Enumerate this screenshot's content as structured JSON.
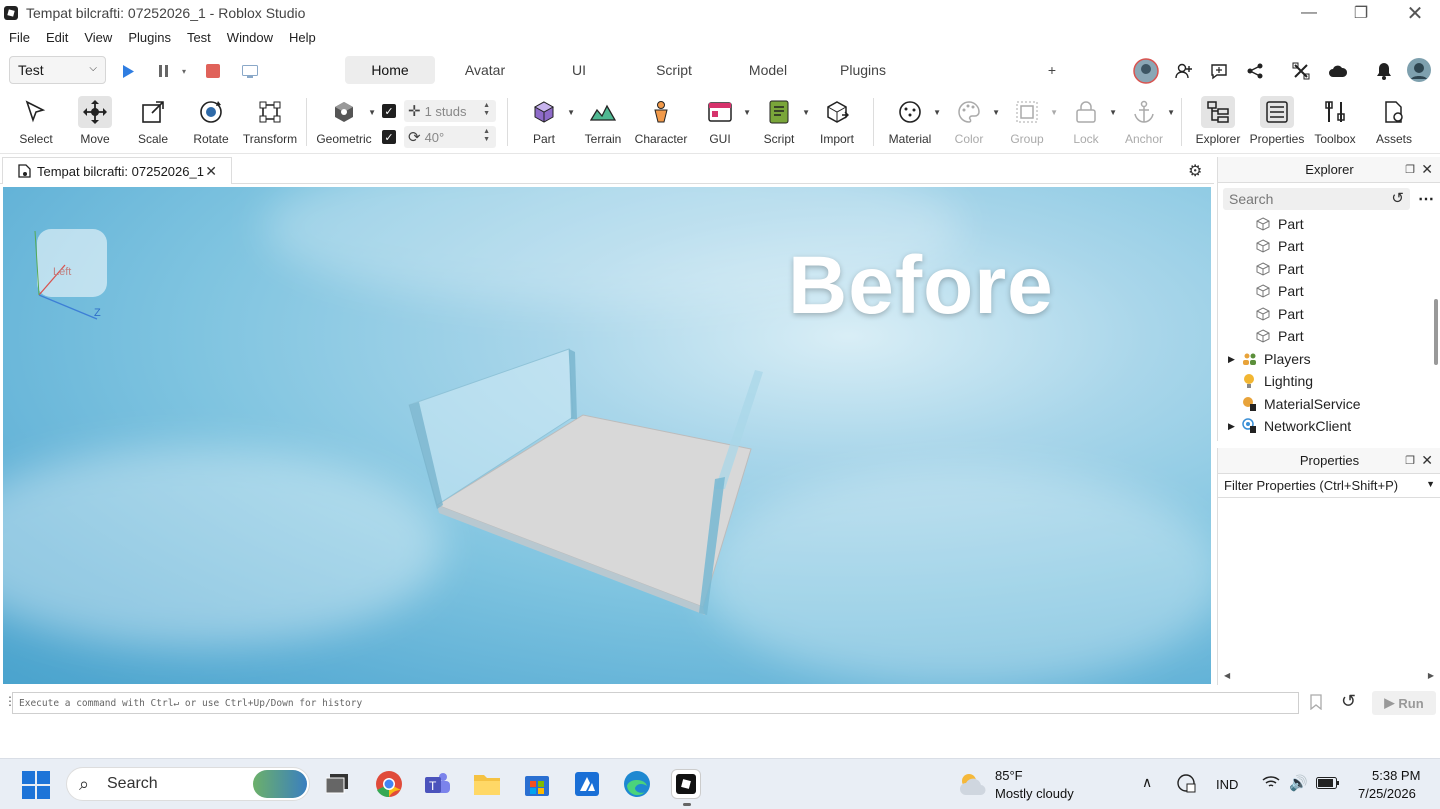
{
  "window": {
    "title": "Tempat bilcrafti: 07252026_1 - Roblox Studio"
  },
  "menu": [
    "File",
    "Edit",
    "View",
    "Plugins",
    "Test",
    "Window",
    "Help"
  ],
  "mode_select": {
    "value": "Test"
  },
  "ribbon_tabs": [
    {
      "label": "Home",
      "active": true
    },
    {
      "label": "Avatar",
      "active": false
    },
    {
      "label": "UI",
      "active": false
    },
    {
      "label": "Script",
      "active": false
    },
    {
      "label": "Model",
      "active": false
    },
    {
      "label": "Plugins",
      "active": false
    }
  ],
  "ribbon_add": "+",
  "tools": {
    "select": "Select",
    "move": "Move",
    "scale": "Scale",
    "rotate": "Rotate",
    "transform": "Transform",
    "geometric": "Geometric",
    "part": "Part",
    "terrain": "Terrain",
    "character": "Character",
    "gui": "GUI",
    "script": "Script",
    "import": "Import",
    "material": "Material",
    "color": "Color",
    "group": "Group",
    "lock": "Lock",
    "anchor": "Anchor",
    "explorer": "Explorer",
    "properties": "Properties",
    "toolbox": "Toolbox",
    "assets": "Assets"
  },
  "snap": {
    "move_value": "1 studs",
    "rotate_value": "40°"
  },
  "doc_tab": {
    "label": "Tempat bilcrafti: 07252026_1"
  },
  "viewport": {
    "overlay_text": "Before",
    "gizmo_face": "Left",
    "axis_z": "Z"
  },
  "explorer": {
    "title": "Explorer",
    "search_placeholder": "Search",
    "items": [
      {
        "label": "Part",
        "icon": "part-icon"
      },
      {
        "label": "Part",
        "icon": "part-icon"
      },
      {
        "label": "Part",
        "icon": "part-icon"
      },
      {
        "label": "Part",
        "icon": "part-icon"
      },
      {
        "label": "Part",
        "icon": "part-icon"
      },
      {
        "label": "Part",
        "icon": "part-icon"
      },
      {
        "label": "Players",
        "icon": "players-icon",
        "expandable": true
      },
      {
        "label": "Lighting",
        "icon": "lighting-icon"
      },
      {
        "label": "MaterialService",
        "icon": "material-service-icon"
      },
      {
        "label": "NetworkClient",
        "icon": "network-client-icon",
        "expandable": true
      }
    ]
  },
  "properties": {
    "title": "Properties",
    "filter_placeholder": "Filter Properties (Ctrl+Shift+P)"
  },
  "command_bar": {
    "placeholder": "Execute a command with Ctrl↵ or use Ctrl+Up/Down for history",
    "run_label": "Run"
  },
  "taskbar": {
    "search_label": "Search",
    "weather_temp": "85°F",
    "weather_desc": "Mostly cloudy",
    "language": "IND",
    "time": "5:38 PM",
    "date": "7/25/2026"
  },
  "colors": {
    "accent_blue": "#2f7de1",
    "stop_red": "#e0625a",
    "viewport_sky": "#6fbbdc"
  }
}
